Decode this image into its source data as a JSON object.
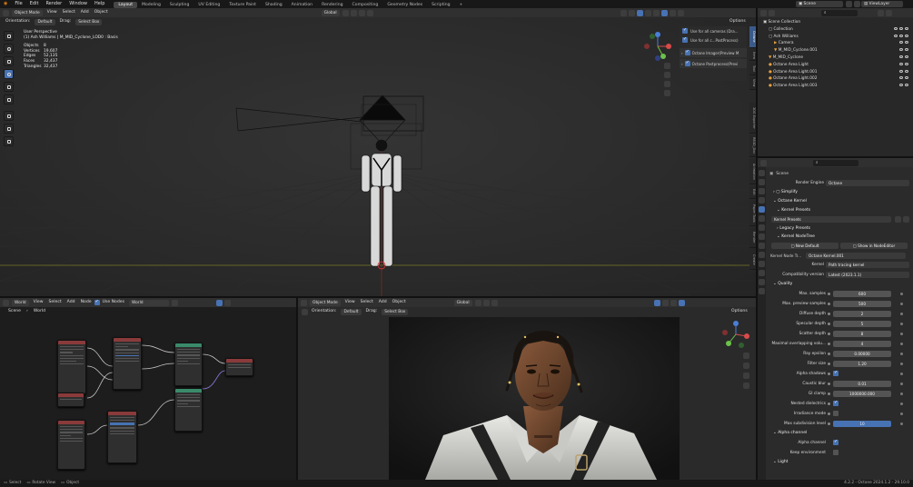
{
  "topbar": {
    "menus": [
      "File",
      "Edit",
      "Render",
      "Window",
      "Help"
    ],
    "workspaces": [
      "Layout",
      "Modeling",
      "Sculpting",
      "UV Editing",
      "Texture Paint",
      "Shading",
      "Animation",
      "Rendering",
      "Compositing",
      "Geometry Nodes",
      "Scripting"
    ],
    "active_workspace": "Layout",
    "scene_name": "Scene",
    "view_layer": "ViewLayer"
  },
  "viewport_top": {
    "mode": "Object Mode",
    "menus": [
      "View",
      "Select",
      "Add",
      "Object"
    ],
    "transform": "Global",
    "orientation_label": "Orientation:",
    "orientation_value": "Default",
    "drag_label": "Drag:",
    "drag_value": "Select Box",
    "options_label": "Options",
    "overlay_title": "User Perspective",
    "overlay_subtitle": "(1) Ash Williams | M_MID_Cyclone_LOD0 : Basis",
    "stats": [
      {
        "label": "Objects",
        "value": "8"
      },
      {
        "label": "Vertices",
        "value": "19,607"
      },
      {
        "label": "Edges",
        "value": "52,135"
      },
      {
        "label": "Faces",
        "value": "32,437"
      },
      {
        "label": "Triangles",
        "value": "32,437"
      }
    ],
    "octane_panel": {
      "use_all_cameras": "Use for all cameras (Dra...",
      "use_all_postprocess": "Use for all c...PostProcess)",
      "imager": "Octane Imager(Preview M",
      "postprocess": "Octane Postprocess(Previ"
    },
    "side_tabs": [
      "Octane",
      "Item",
      "Tool",
      "View",
      "3DG Exporter",
      "RB3D_Doc",
      "Animation",
      "Edit",
      "Paper Tools",
      "Render",
      "Create"
    ]
  },
  "outliner": {
    "search_placeholder": "",
    "items": [
      {
        "label": "Scene Collection",
        "indent": 0
      },
      {
        "label": "Collection",
        "indent": 1
      },
      {
        "label": "Ash Williams",
        "indent": 1
      },
      {
        "label": "Camera",
        "indent": 2
      },
      {
        "label": "M_MID_Cyclone.001",
        "indent": 2
      },
      {
        "label": "M_MID_Cyclone",
        "indent": 1
      },
      {
        "label": "Octane Area Light",
        "indent": 1
      },
      {
        "label": "Octane Area Light.001",
        "indent": 1
      },
      {
        "label": "Octane Area Light.002",
        "indent": 1
      },
      {
        "label": "Octane Area Light.003",
        "indent": 1
      }
    ]
  },
  "properties": {
    "breadcrumb": "Scene",
    "render_engine_label": "Render Engine",
    "render_engine_value": "Octane",
    "simplify": "Simplify",
    "octane_kernel": "Octane Kernel",
    "kernel_presets_label": "Kernel Presets",
    "kernel_presets_value": "Kernel Presets",
    "legacy_presets": "Legacy Presets",
    "kernel_nodetree": "Kernel NodeTree",
    "new_default": "New Default",
    "show_in_nodeeditor": "Show in NodeEditor",
    "kernel_node_label": "Kernel Node Tr...",
    "kernel_node_value": "Octane Kernel.001",
    "kernel_label": "Kernel",
    "kernel_value": "Path tracing kernel",
    "compat_label": "Compatibility version",
    "compat_value": "Latest (2023.1.1)",
    "quality_title": "Quality",
    "quality": [
      {
        "label": "Max. samples",
        "value": "600",
        "type": "field"
      },
      {
        "label": "Max. preview samples",
        "value": "500",
        "type": "field"
      },
      {
        "label": "Diffuse depth",
        "value": "2",
        "type": "field"
      },
      {
        "label": "Specular depth",
        "value": "5",
        "type": "field"
      },
      {
        "label": "Scatter depth",
        "value": "8",
        "type": "field"
      },
      {
        "label": "Maximal overlapping volu...",
        "value": "4",
        "type": "field"
      },
      {
        "label": "Ray epsilon",
        "value": "0.00000",
        "type": "field"
      },
      {
        "label": "Filter size",
        "value": "1.20",
        "type": "field"
      },
      {
        "label": "Alpha shadows",
        "value": "",
        "type": "check_on"
      },
      {
        "label": "Caustic blur",
        "value": "0.01",
        "type": "field"
      },
      {
        "label": "GI clamp",
        "value": "1000000.000",
        "type": "field"
      },
      {
        "label": "Nested dielectrics",
        "value": "",
        "type": "check_on"
      },
      {
        "label": "Irradiance mode",
        "value": "",
        "type": "check_off"
      },
      {
        "label": "Max subdivision level",
        "value": "10",
        "type": "field_blue"
      }
    ],
    "alpha_title": "Alpha channel",
    "alpha": [
      {
        "label": "Alpha channel",
        "type": "check_on"
      },
      {
        "label": "Keep environment",
        "type": "check_off"
      }
    ],
    "light_title": "Light"
  },
  "node_editor": {
    "editor": "World",
    "menus": [
      "View",
      "Select",
      "Add",
      "Node"
    ],
    "use_nodes": "Use Nodes",
    "world_value": "World",
    "breadcrumb_scene": "Scene",
    "breadcrumb_world": "World"
  },
  "viewport_bottom": {
    "mode": "Object Mode",
    "menus": [
      "View",
      "Select",
      "Add",
      "Object"
    ],
    "transform": "Global",
    "orientation_label": "Orientation:",
    "orientation_value": "Default",
    "drag_label": "Drag:",
    "drag_value": "Select Box",
    "options_label": "Options"
  },
  "footer": {
    "select": "Select",
    "rotate": "Rotate View",
    "object": "Object",
    "version": "4.2.2 - Octane 2024.1.2 - 29.10.0"
  },
  "colors": {
    "accent": "#4772b3",
    "header": "#303030",
    "panel": "#1d1d1d"
  }
}
